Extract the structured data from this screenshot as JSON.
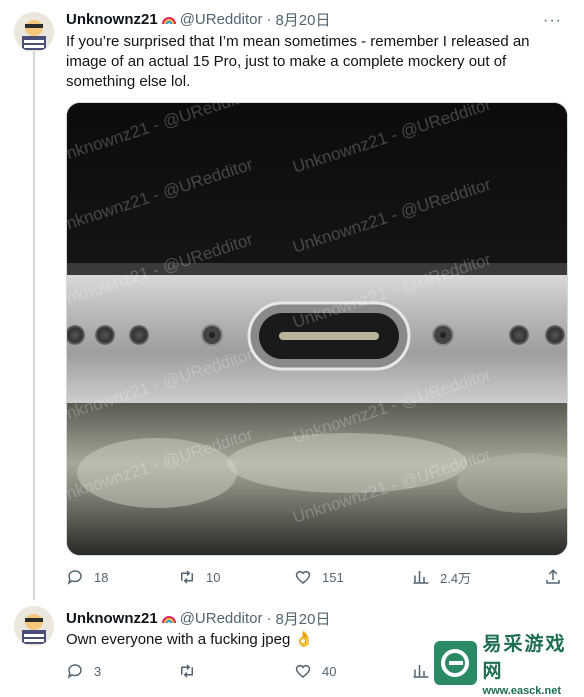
{
  "tweets": [
    {
      "author": "Unknownz21",
      "handle": "@URedditor",
      "separator": "·",
      "date": "8月20日",
      "text": "If you’re surprised that I’m mean sometimes - remember I released an image of an actual 15 Pro, just to make a complete mockery out of something else lol.",
      "media": {
        "watermark_text": "Unknownz21 - @URedditor"
      },
      "actions": {
        "replies": "18",
        "retweets": "10",
        "likes": "151",
        "views": "2.4万"
      }
    },
    {
      "author": "Unknownz21",
      "handle": "@URedditor",
      "separator": "·",
      "date": "8月20日",
      "text": "Own everyone with a fucking jpeg 👌",
      "actions": {
        "replies": "3",
        "likes": "40"
      }
    }
  ],
  "more_menu": "···",
  "site_watermark": {
    "name": "易采游戏网",
    "url": "www.easck.net"
  },
  "colors": {
    "text_primary": "#0f1419",
    "text_secondary": "#536471",
    "divider": "#cfd9de",
    "watermark_green": "#1d6d4f"
  }
}
